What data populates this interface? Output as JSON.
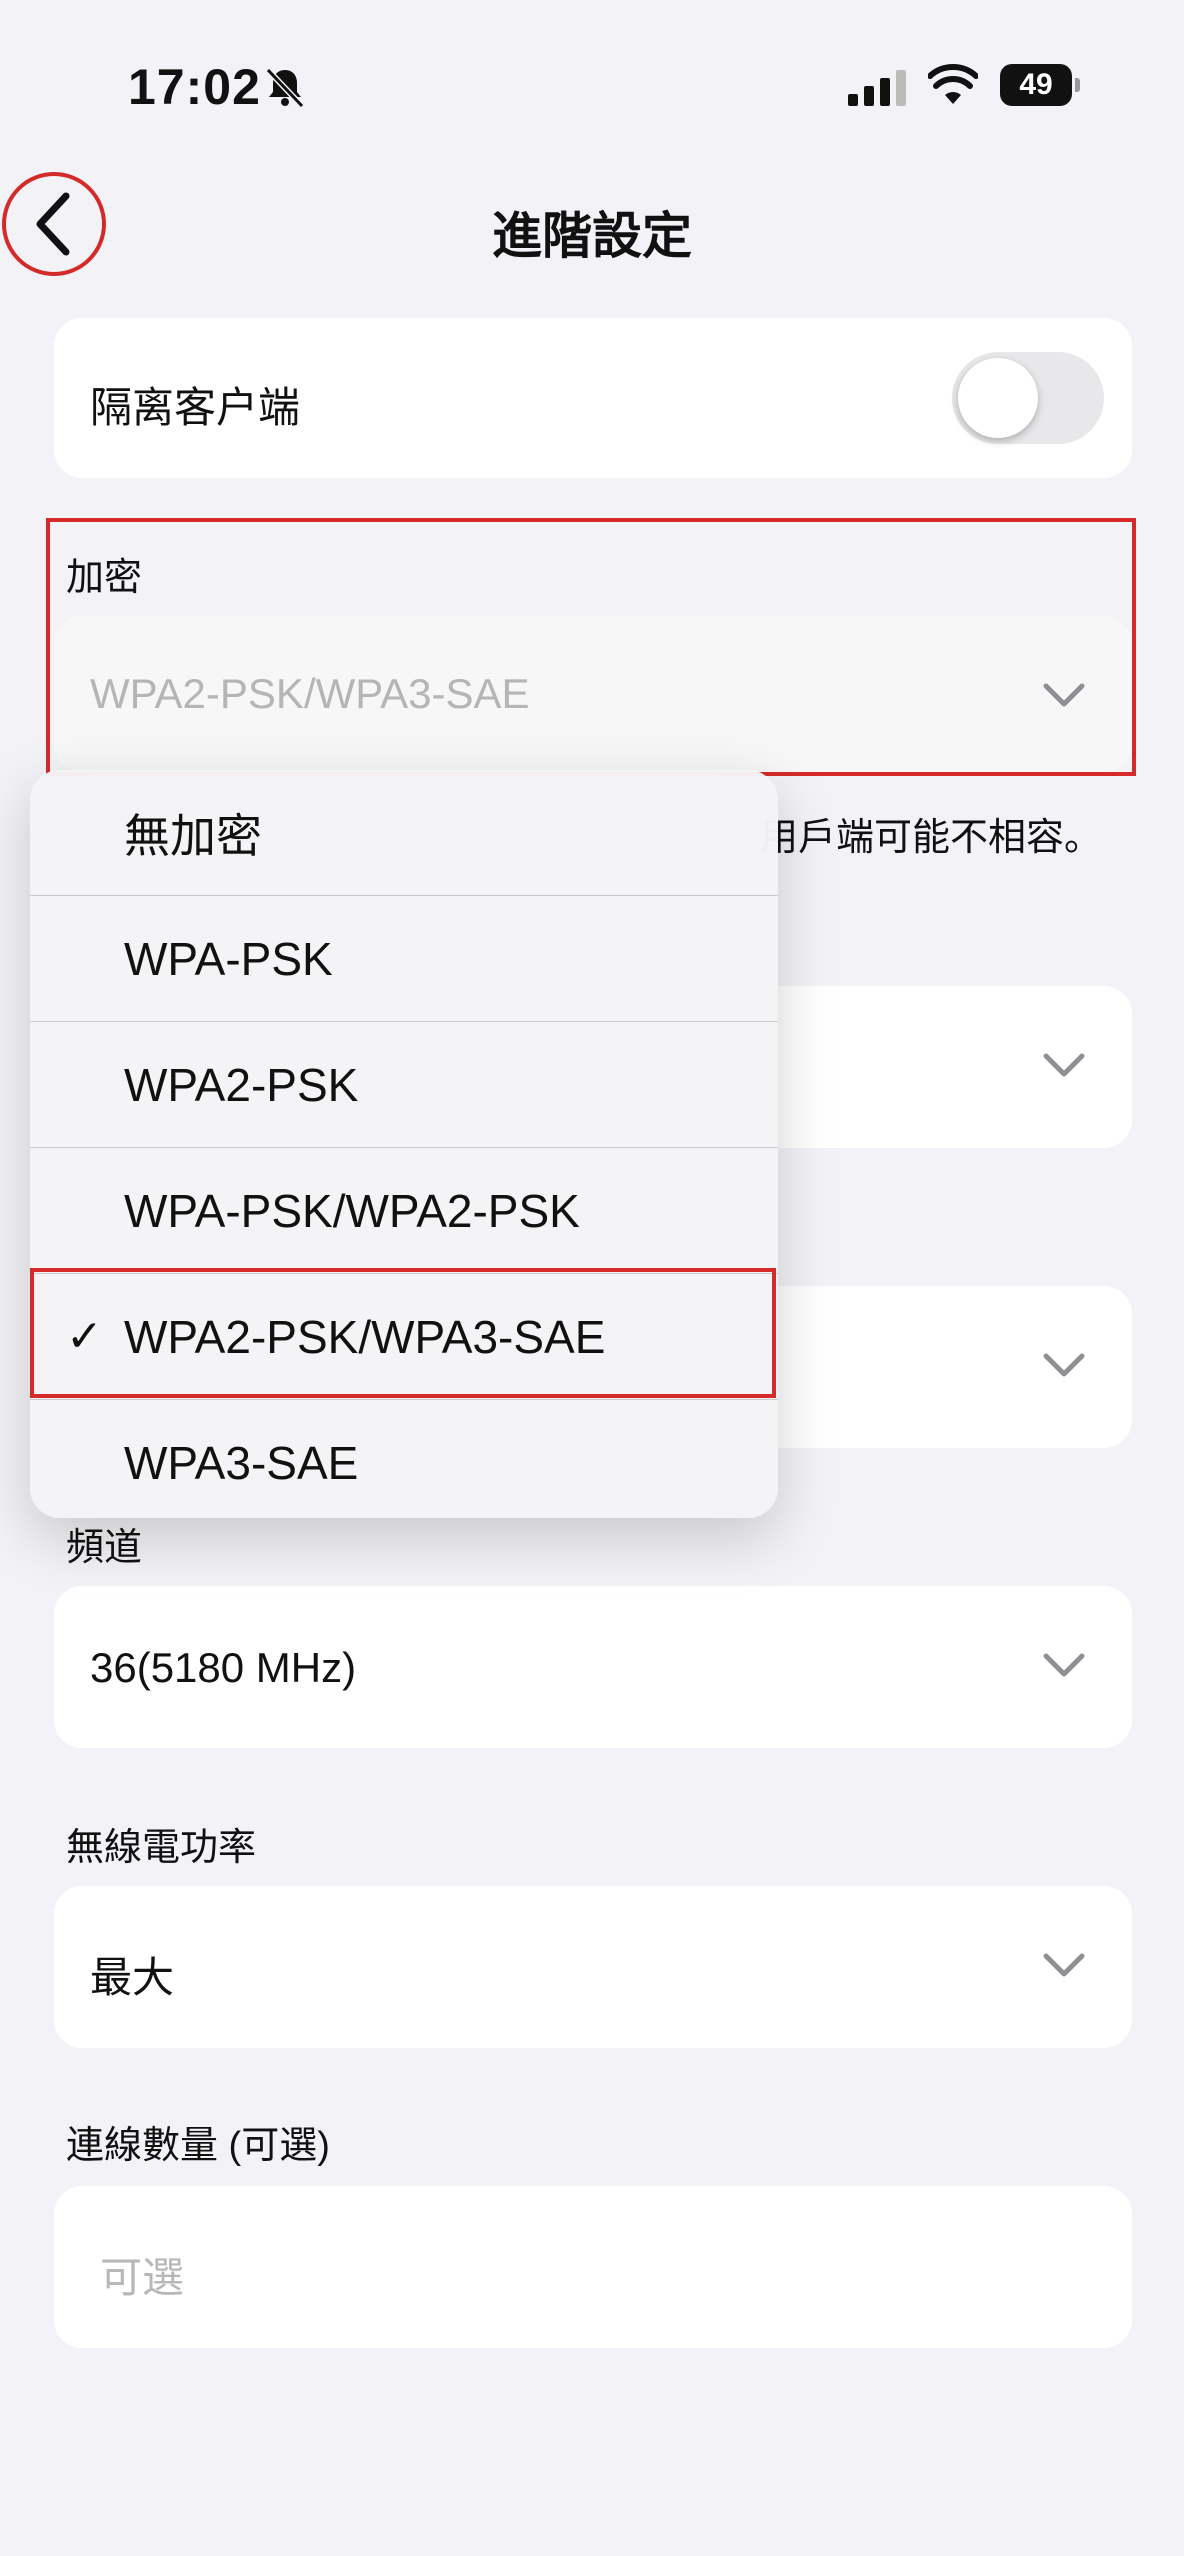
{
  "status_bar": {
    "time": "17:02",
    "battery": "49"
  },
  "header": {
    "title": "進階設定"
  },
  "isolate_clients": {
    "label": "隔离客户端",
    "enabled": false
  },
  "encryption": {
    "label": "加密",
    "value": "WPA2-PSK/WPA3-SAE",
    "note_fragment": "用戶端可能不相容。",
    "options": [
      "無加密",
      "WPA-PSK",
      "WPA2-PSK",
      "WPA-PSK/WPA2-PSK",
      "WPA2-PSK/WPA3-SAE",
      "WPA3-SAE"
    ],
    "selected": "WPA2-PSK/WPA3-SAE"
  },
  "channel": {
    "label": "頻道",
    "value": "36(5180 MHz)"
  },
  "tx_power": {
    "label": "無線電功率",
    "value": "最大"
  },
  "connections": {
    "label": "連線數量 (可選)",
    "placeholder": "可選"
  },
  "colors": {
    "accent_red": "#d42a2a",
    "background": "#f3f3f7"
  }
}
